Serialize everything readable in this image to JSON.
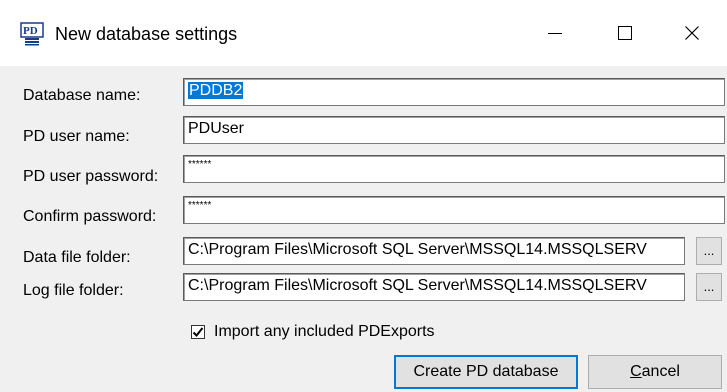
{
  "window": {
    "title": "New database settings",
    "icon": "pd-database-icon"
  },
  "form": {
    "database_name": {
      "label": "Database name:",
      "value": "PDDB2"
    },
    "user_name": {
      "label": "PD user name:",
      "value": "PDUser"
    },
    "user_password": {
      "label": "PD user password:",
      "value": "******"
    },
    "confirm_password": {
      "label": "Confirm password:",
      "value": "******"
    },
    "data_folder": {
      "label": "Data file folder:",
      "value": "C:\\Program Files\\Microsoft SQL Server\\MSSQL14.MSSQLSERV",
      "browse_label": "..."
    },
    "log_folder": {
      "label": "Log file folder:",
      "value": "C:\\Program Files\\Microsoft SQL Server\\MSSQL14.MSSQLSERV",
      "browse_label": "..."
    }
  },
  "import_option": {
    "label": "Import any included PDExports",
    "checked": true
  },
  "buttons": {
    "create_label": "Create PD database",
    "cancel_label_first": "C",
    "cancel_label_rest": "ancel"
  },
  "colors": {
    "selection": "#0078d7",
    "default_button_border": "#0078d7"
  }
}
